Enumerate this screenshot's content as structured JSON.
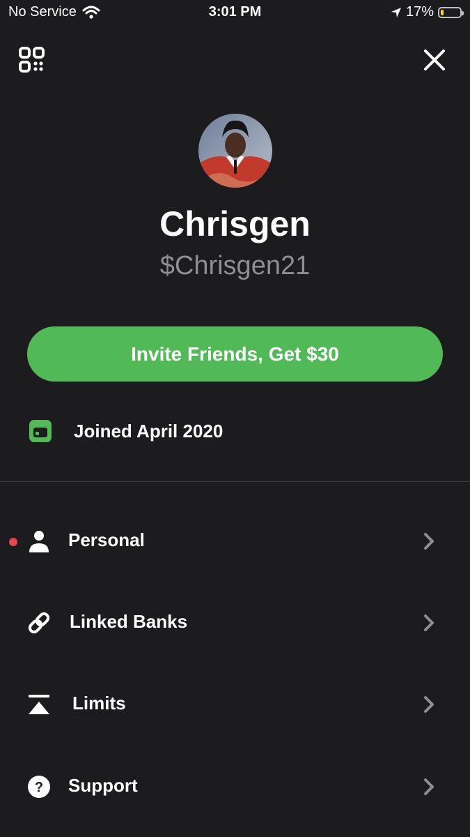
{
  "status_bar": {
    "carrier": "No Service",
    "time": "3:01 PM",
    "battery": "17%",
    "battery_level": 0.17
  },
  "header": {
    "qr_icon": "qr-code-icon",
    "close_icon": "close-icon"
  },
  "profile": {
    "display_name": "Chrisgen",
    "cashtag": "$Chrisgen21"
  },
  "invite": {
    "label": "Invite Friends, Get $30"
  },
  "joined": {
    "icon": "calendar-icon",
    "text": "Joined April 2020"
  },
  "menu": {
    "items": [
      {
        "label": "Personal",
        "icon": "person-icon",
        "has_notification": true
      },
      {
        "label": "Linked Banks",
        "icon": "link-icon",
        "has_notification": false
      },
      {
        "label": "Limits",
        "icon": "limits-icon",
        "has_notification": false
      },
      {
        "label": "Support",
        "icon": "question-icon",
        "has_notification": false
      }
    ]
  },
  "colors": {
    "background": "#1c1c1e",
    "accent_green": "#52b957",
    "notification_red": "#e5484d",
    "muted_text": "#8e8e93"
  }
}
